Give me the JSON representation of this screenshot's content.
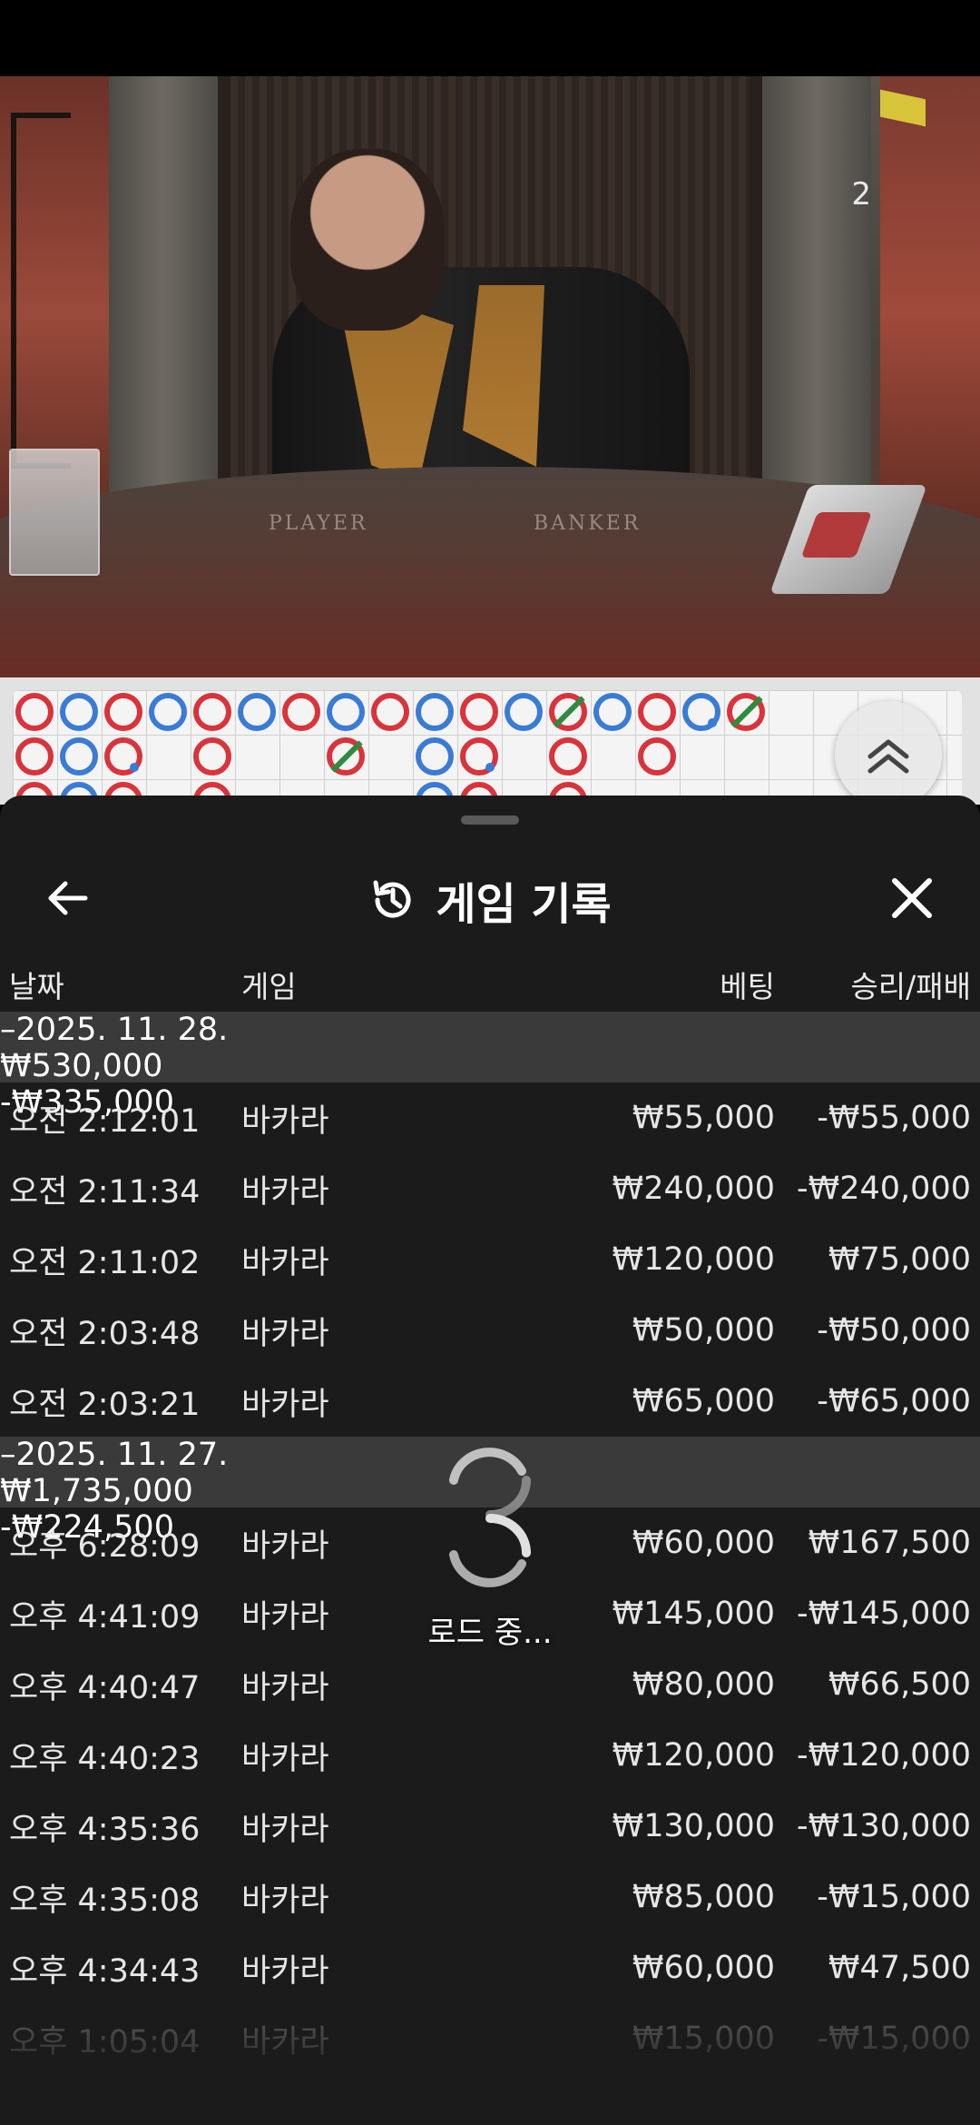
{
  "video": {
    "round_number": "2",
    "table_labels": {
      "player": "PLAYER",
      "banker": "BANKER"
    }
  },
  "colors": {
    "banker_red": "#d9333b",
    "player_blue": "#3a7bd5",
    "tie_green": "#2e8b3e",
    "sheet_bg": "#1b1b1b",
    "group_bg": "#3a3a3a"
  },
  "header": {
    "title": "게임 기록",
    "back_icon": "arrow-left-icon",
    "history_icon": "history-clock-icon",
    "close_icon": "close-icon"
  },
  "columns": {
    "date": "날짜",
    "game": "게임",
    "bet": "베팅",
    "win_loss": "승리/패배"
  },
  "groups": [
    {
      "date": "–2025. 11. 28.",
      "bet": "₩530,000",
      "win_loss": "-₩335,000",
      "rows": [
        {
          "time": "오전 2:12:01",
          "game": "바카라",
          "bet": "₩55,000",
          "win_loss": "-₩55,000"
        },
        {
          "time": "오전 2:11:34",
          "game": "바카라",
          "bet": "₩240,000",
          "win_loss": "-₩240,000"
        },
        {
          "time": "오전 2:11:02",
          "game": "바카라",
          "bet": "₩120,000",
          "win_loss": "₩75,000"
        },
        {
          "time": "오전 2:03:48",
          "game": "바카라",
          "bet": "₩50,000",
          "win_loss": "-₩50,000"
        },
        {
          "time": "오전 2:03:21",
          "game": "바카라",
          "bet": "₩65,000",
          "win_loss": "-₩65,000"
        }
      ]
    },
    {
      "date": "–2025. 11. 27.",
      "bet": "₩1,735,000",
      "win_loss": "-₩224,500",
      "rows": [
        {
          "time": "오후 6:28:09",
          "game": "바카라",
          "bet": "₩60,000",
          "win_loss": "₩167,500"
        },
        {
          "time": "오후 4:41:09",
          "game": "바카라",
          "bet": "₩145,000",
          "win_loss": "-₩145,000"
        },
        {
          "time": "오후 4:40:47",
          "game": "바카라",
          "bet": "₩80,000",
          "win_loss": "₩66,500"
        },
        {
          "time": "오후 4:40:23",
          "game": "바카라",
          "bet": "₩120,000",
          "win_loss": "-₩120,000"
        },
        {
          "time": "오후 4:35:36",
          "game": "바카라",
          "bet": "₩130,000",
          "win_loss": "-₩130,000"
        },
        {
          "time": "오후 4:35:08",
          "game": "바카라",
          "bet": "₩85,000",
          "win_loss": "-₩15,000"
        },
        {
          "time": "오후 4:34:43",
          "game": "바카라",
          "bet": "₩60,000",
          "win_loss": "₩47,500"
        },
        {
          "time": "오후 1:05:04",
          "game": "바카라",
          "bet": "₩15,000",
          "win_loss": "-₩15,000"
        }
      ]
    }
  ],
  "loading": {
    "label": "로드 중...",
    "icon": "spinner-icon"
  }
}
